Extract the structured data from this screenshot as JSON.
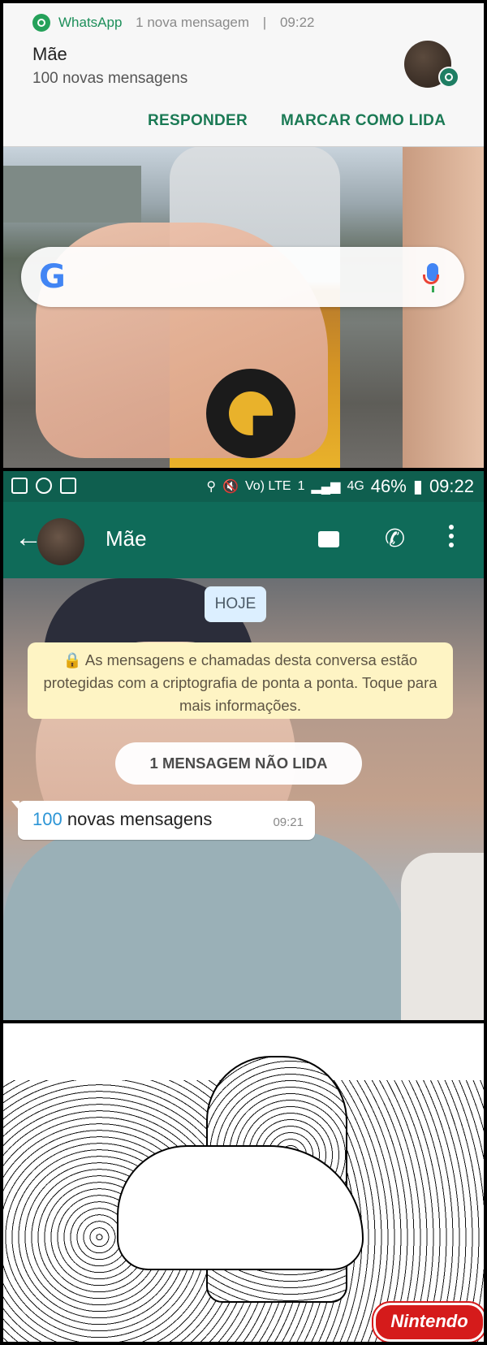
{
  "notification": {
    "app_name": "WhatsApp",
    "summary": "1 nova mensagem",
    "separator": "|",
    "time": "09:22",
    "sender": "Mãe",
    "text": "100 novas mensagens",
    "actions": {
      "reply": "RESPONDER",
      "mark_read": "MARCAR COMO LIDA"
    }
  },
  "google_search": {
    "logo": "G",
    "mic_icon": "mic-icon"
  },
  "status_bar": {
    "battery": "46%",
    "time": "09:22",
    "signal_labels": {
      "volte": "Vo) LTE",
      "sim": "1",
      "network": "4G"
    }
  },
  "chat": {
    "contact_name": "Mãe",
    "date_chip": "HOJE",
    "encryption_notice": "🔒 As mensagens e chamadas desta conversa estão protegidas com a criptografia de ponta a ponta. Toque para mais informações.",
    "unread_banner": "1 MENSAGEM NÃO LIDA",
    "message": {
      "number": "100",
      "text": " novas mensagens",
      "time": "09:21"
    }
  },
  "watermark": {
    "text": "Nintendo"
  },
  "colors": {
    "whatsapp_green": "#0f6b59",
    "action_green": "#1b7a55",
    "nintendo_red": "#d51b1b"
  }
}
